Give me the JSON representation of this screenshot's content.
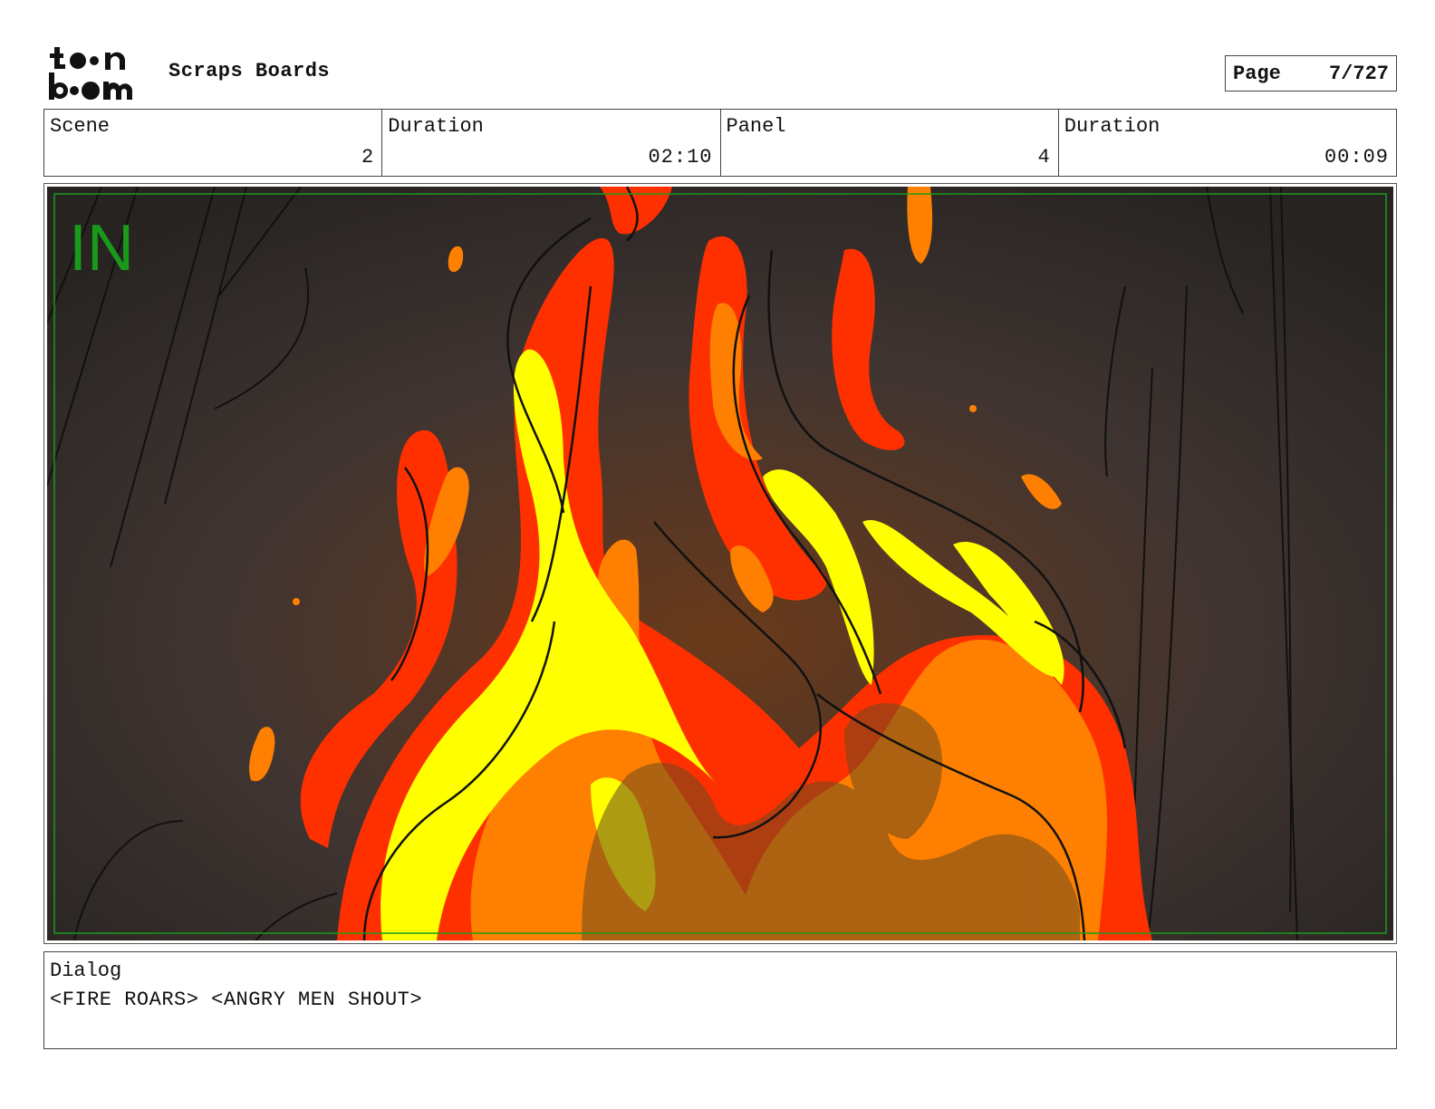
{
  "header": {
    "logo_text": "toon boom",
    "project_title": "Scraps Boards",
    "page_label": "Page",
    "page_value": "7/727"
  },
  "info": {
    "scene_label": "Scene",
    "scene_value": "2",
    "scene_duration_label": "Duration",
    "scene_duration_value": "02:10",
    "panel_label": "Panel",
    "panel_value": "4",
    "panel_duration_label": "Duration",
    "panel_duration_value": "00:09"
  },
  "panel": {
    "transition_marker": "IN",
    "marker_color": "#1a9a1a",
    "description": "",
    "colors": {
      "background_dark": "#2a2624",
      "glow": "#6a3a1a",
      "flame_red": "#ff3000",
      "flame_orange": "#ff8000",
      "flame_yellow": "#ffff00",
      "ink": "#111111"
    }
  },
  "dialog": {
    "label": "Dialog",
    "text": "<FIRE ROARS> <ANGRY MEN SHOUT>"
  }
}
